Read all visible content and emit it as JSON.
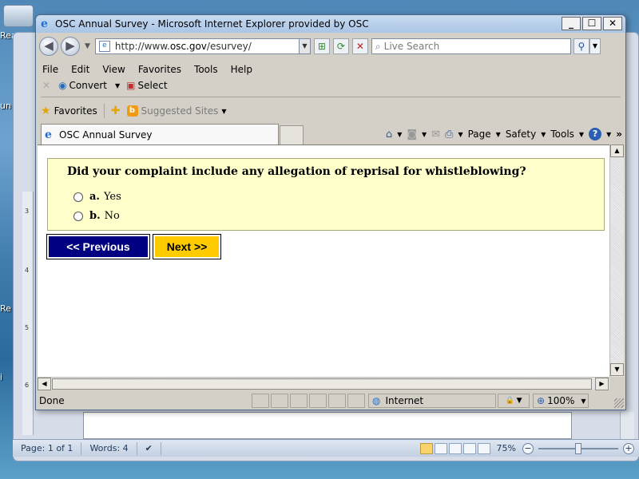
{
  "desktop": {
    "icon_label_1": "RealP",
    "icon_label_2": "un",
    "icon_label_3": "Re",
    "icon_label_4": "i"
  },
  "browser": {
    "title": "OSC Annual Survey - Microsoft Internet Explorer provided by OSC",
    "window_buttons": {
      "minimize": "_",
      "maximize": "☐",
      "close": "✕"
    },
    "address_prefix": "http://www.",
    "address_domain": "osc.gov",
    "address_path": "/esurvey/",
    "search_placeholder": "Live Search",
    "menu": [
      "File",
      "Edit",
      "View",
      "Favorites",
      "Tools",
      "Help"
    ],
    "toolbar": {
      "convert": "Convert",
      "select": "Select"
    },
    "favorites": {
      "label": "Favorites",
      "suggested": "Suggested Sites"
    },
    "tab_title": "OSC Annual Survey",
    "commands": {
      "page": "Page",
      "safety": "Safety",
      "tools": "Tools"
    },
    "status": {
      "text": "Done",
      "zone": "Internet",
      "zoom": "100%"
    }
  },
  "survey": {
    "question": "Did your complaint include any allegation of reprisal for whistleblowing?",
    "options": [
      {
        "letter": "a.",
        "text": "Yes"
      },
      {
        "letter": "b.",
        "text": "No"
      }
    ],
    "prev_label": "<< Previous",
    "next_label": "Next >>"
  },
  "word": {
    "page": "Page: 1 of 1",
    "words": "Words: 4",
    "zoom": "75%",
    "ruler_marks": [
      "3",
      "4",
      "5",
      "6"
    ]
  },
  "colors": {
    "question_bg": "#ffffcc",
    "prev_bg": "#000080",
    "next_bg": "#ffcc00"
  }
}
